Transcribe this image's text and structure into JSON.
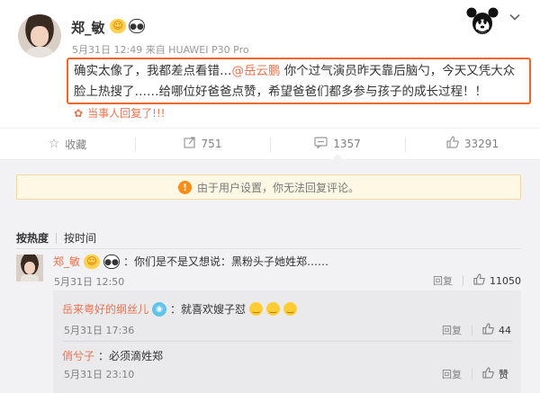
{
  "post": {
    "author": "郑_敏",
    "badges": [
      "vip-emoji-badge",
      "panda-badge"
    ],
    "meta": "5月31日 12:49 来自 HUAWEI P30 Pro",
    "content_before": "确实太像了，我都差点看错…",
    "mention": "@岳云鹏",
    "content_after": " 你个过气演员昨天靠后脑勺，今天又凭大众脸上热搜了……给哪位好爸爸点赞，希望爸爸们都多参与孩子的成长过程！！",
    "reply_note": "当事人回复了!!!",
    "colors": {
      "highlight_border": "#f26522",
      "accent": "#eb7350"
    }
  },
  "actions": [
    {
      "icon": "star-icon",
      "label": "收藏"
    },
    {
      "icon": "forward-icon",
      "label": "751"
    },
    {
      "icon": "comment-icon",
      "label": "1357"
    },
    {
      "icon": "thumbs-up-icon",
      "label": "33291"
    }
  ],
  "notice": {
    "text": "由于用户设置，你无法回复评论。"
  },
  "sort": {
    "hot": "按热度",
    "time": "按时间"
  },
  "comments": [
    {
      "author": "郑_敏",
      "text": "：你们是不是又想说：黑粉头子她姓郑……",
      "date": "5月31日 12:50",
      "reply_label": "回复",
      "likes": "11050",
      "subcomments": [
        {
          "author": "岳来粤好的纲丝儿",
          "text": "：就喜欢嫂子怼",
          "date": "5月31日 17:36",
          "reply_label": "回复",
          "likes": "44"
        },
        {
          "author": "俏兮子",
          "text": "：必须滴姓郑",
          "date": "5月31日 23:10",
          "reply_label": "回复",
          "likes": "赞"
        }
      ]
    }
  ]
}
